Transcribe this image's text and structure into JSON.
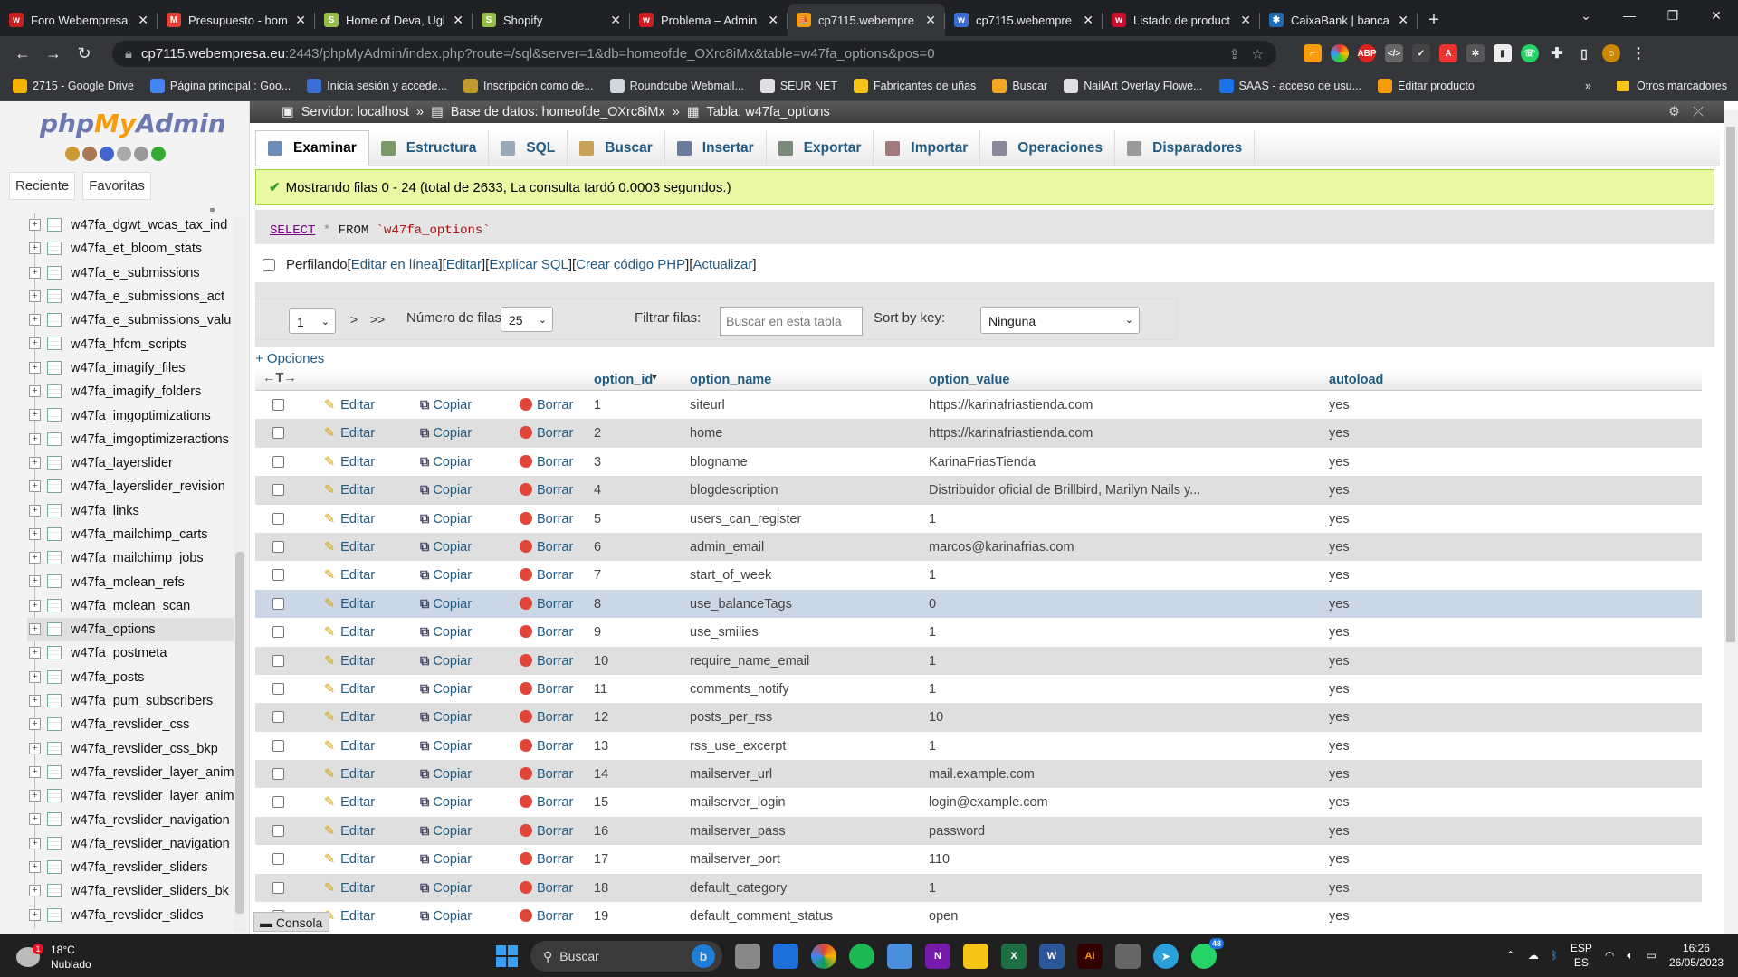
{
  "browser": {
    "tabs": [
      {
        "title": "Foro Webempresa",
        "color": "#cc1f1f",
        "glyph": "w"
      },
      {
        "title": "Presupuesto - hom",
        "color": "#e44134",
        "glyph": "M"
      },
      {
        "title": "Home of Deva, Ugl",
        "color": "#95bf47",
        "glyph": "S"
      },
      {
        "title": "Shopify",
        "color": "#95bf47",
        "glyph": "S"
      },
      {
        "title": "Problema – Admin",
        "color": "#cc1f1f",
        "glyph": "w"
      },
      {
        "title": "cp7115.webempre",
        "color": "#f89c0e",
        "glyph": "⛵"
      },
      {
        "title": "cp7115.webempre",
        "color": "#3b6fd6",
        "glyph": "w"
      },
      {
        "title": "Listado de product",
        "color": "#c8102e",
        "glyph": "w"
      },
      {
        "title": "CaixaBank | banca",
        "color": "#1c6bb4",
        "glyph": "✱"
      }
    ],
    "active_tab": 5,
    "new_tab": "+",
    "url_host": "cp7115.webempresa.eu",
    "url_path": ":2443/phpMyAdmin/index.php?route=/sql&server=1&db=homeofde_OXrc8iMx&table=w47fa_options&pos=0",
    "bookmarks": [
      {
        "label": "2715 - Google Drive",
        "color": "#f4b400"
      },
      {
        "label": "Página principal : Goo...",
        "color": "#4285f4"
      },
      {
        "label": "Inicia sesión y accede...",
        "color": "#3b6fd6"
      },
      {
        "label": "Inscripción como de...",
        "color": "#c19a2e"
      },
      {
        "label": "Roundcube Webmail...",
        "color": "#cfd8dc"
      },
      {
        "label": "SEUR NET",
        "color": "#e0e0e0"
      },
      {
        "label": "Fabricantes de uñas",
        "color": "#f5c518"
      },
      {
        "label": "Buscar",
        "color": "#f5a623"
      },
      {
        "label": "NailArt Overlay Flowe...",
        "color": "#e0e0e0"
      },
      {
        "label": "SAAS - acceso de usu...",
        "color": "#1a73e8"
      },
      {
        "label": "Editar producto",
        "color": "#f89c0e"
      }
    ],
    "bookmarks_more": "»",
    "other_bookmarks": "Otros marcadores"
  },
  "pma": {
    "logo": {
      "php": "php",
      "my": "My",
      "admin": "Admin"
    },
    "side_tabs": [
      "Reciente",
      "Favoritas"
    ],
    "tables": [
      "w47fa_dgwt_wcas_tax_ind",
      "w47fa_et_bloom_stats",
      "w47fa_e_submissions",
      "w47fa_e_submissions_act",
      "w47fa_e_submissions_valu",
      "w47fa_hfcm_scripts",
      "w47fa_imagify_files",
      "w47fa_imagify_folders",
      "w47fa_imgoptimizations",
      "w47fa_imgoptimizeractions",
      "w47fa_layerslider",
      "w47fa_layerslider_revision",
      "w47fa_links",
      "w47fa_mailchimp_carts",
      "w47fa_mailchimp_jobs",
      "w47fa_mclean_refs",
      "w47fa_mclean_scan",
      "w47fa_options",
      "w47fa_postmeta",
      "w47fa_posts",
      "w47fa_pum_subscribers",
      "w47fa_revslider_css",
      "w47fa_revslider_css_bkp",
      "w47fa_revslider_layer_anim",
      "w47fa_revslider_layer_anim",
      "w47fa_revslider_navigation",
      "w47fa_revslider_navigation",
      "w47fa_revslider_sliders",
      "w47fa_revslider_sliders_bk",
      "w47fa_revslider_slides"
    ],
    "selected_table": "w47fa_options",
    "breadcrumb": {
      "server": "Servidor: localhost",
      "sep1": "»",
      "db": "Base de datos: homeofde_OXrc8iMx",
      "sep2": "»",
      "table": "Tabla: w47fa_options"
    },
    "menu": [
      "Examinar",
      "Estructura",
      "SQL",
      "Buscar",
      "Insertar",
      "Exportar",
      "Importar",
      "Operaciones",
      "Disparadores"
    ],
    "success": "Mostrando filas 0 - 24 (total de 2633, La consulta tardó 0.0003 segundos.)",
    "sql": {
      "select": "SELECT",
      "star": "*",
      "from": "FROM",
      "table": "`w47fa_options`"
    },
    "profiling": {
      "label": "Perfilando",
      "links": [
        "Editar en línea",
        "Editar",
        "Explicar SQL",
        "Crear código PHP",
        "Actualizar"
      ]
    },
    "nav": {
      "page": "1",
      "next": ">",
      "last": ">>",
      "rows_label": "Número de filas:",
      "rows": "25",
      "filter_label": "Filtrar filas:",
      "filter_placeholder": "Buscar en esta tabla",
      "sort_label": "Sort by key:",
      "sort_value": "Ninguna"
    },
    "options_link": "+ Opciones",
    "columns": [
      "option_id",
      "option_name",
      "option_value",
      "autoload"
    ],
    "actions": {
      "edit": "Editar",
      "copy": "Copiar",
      "delete": "Borrar"
    },
    "rows": [
      [
        "1",
        "siteurl",
        "https://karinafriastienda.com",
        "yes"
      ],
      [
        "2",
        "home",
        "https://karinafriastienda.com",
        "yes"
      ],
      [
        "3",
        "blogname",
        "KarinaFriasTienda",
        "yes"
      ],
      [
        "4",
        "blogdescription",
        "Distribuidor oficial de Brillbird, Marilyn Nails y...",
        "yes"
      ],
      [
        "5",
        "users_can_register",
        "1",
        "yes"
      ],
      [
        "6",
        "admin_email",
        "marcos@karinafrias.com",
        "yes"
      ],
      [
        "7",
        "start_of_week",
        "1",
        "yes"
      ],
      [
        "8",
        "use_balanceTags",
        "0",
        "yes"
      ],
      [
        "9",
        "use_smilies",
        "1",
        "yes"
      ],
      [
        "10",
        "require_name_email",
        "1",
        "yes"
      ],
      [
        "11",
        "comments_notify",
        "1",
        "yes"
      ],
      [
        "12",
        "posts_per_rss",
        "10",
        "yes"
      ],
      [
        "13",
        "rss_use_excerpt",
        "1",
        "yes"
      ],
      [
        "14",
        "mailserver_url",
        "mail.example.com",
        "yes"
      ],
      [
        "15",
        "mailserver_login",
        "login@example.com",
        "yes"
      ],
      [
        "16",
        "mailserver_pass",
        "password",
        "yes"
      ],
      [
        "17",
        "mailserver_port",
        "110",
        "yes"
      ],
      [
        "18",
        "default_category",
        "1",
        "yes"
      ],
      [
        "19",
        "default_comment_status",
        "open",
        "yes"
      ]
    ],
    "highlighted_row": 7,
    "console": "Consola"
  },
  "taskbar": {
    "temp": "18°C",
    "weather": "Nublado",
    "weather_badge": "1",
    "search": "Buscar",
    "lang1": "ESP",
    "lang2": "ES",
    "time": "16:26",
    "date": "26/05/2023",
    "notif_badge": "48"
  }
}
